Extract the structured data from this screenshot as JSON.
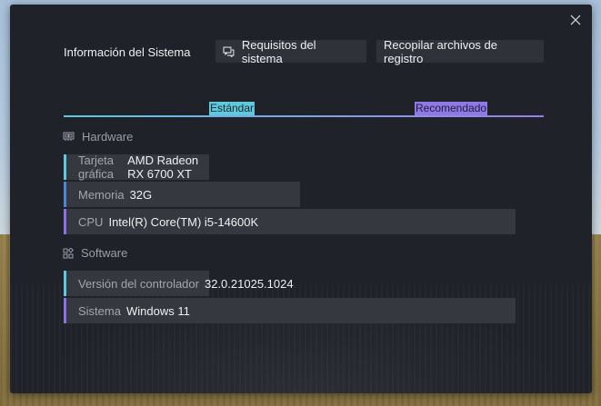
{
  "dialog": {
    "title": "Información del Sistema",
    "buttons": {
      "requirements": "Requisitos del sistema",
      "collect_logs": "Recopilar archivos de registro"
    },
    "close_icon": "close-icon"
  },
  "tabs": [
    {
      "label": "Estándar",
      "color": "#5ec8dd"
    },
    {
      "label": "Recomendado",
      "color": "#8e79e6"
    }
  ],
  "hardware": {
    "title": "Hardware",
    "items": [
      {
        "label": "Tarjeta gráfica",
        "value": "AMD Radeon RX 6700 XT"
      },
      {
        "label": "Memoria",
        "value": "32G"
      },
      {
        "label": "CPU",
        "value": "Intel(R) Core(TM) i5-14600K"
      }
    ]
  },
  "software": {
    "title": "Software",
    "items": [
      {
        "label": "Versión del controlador",
        "value": "32.0.21025.1024"
      },
      {
        "label": "Sistema",
        "value": "Windows 11"
      }
    ]
  },
  "colors": {
    "accent_cyan": "#5ec8dd",
    "accent_purple": "#8e79e6",
    "dialog_bg": "#1f2229",
    "row_bg": "#35383f"
  }
}
